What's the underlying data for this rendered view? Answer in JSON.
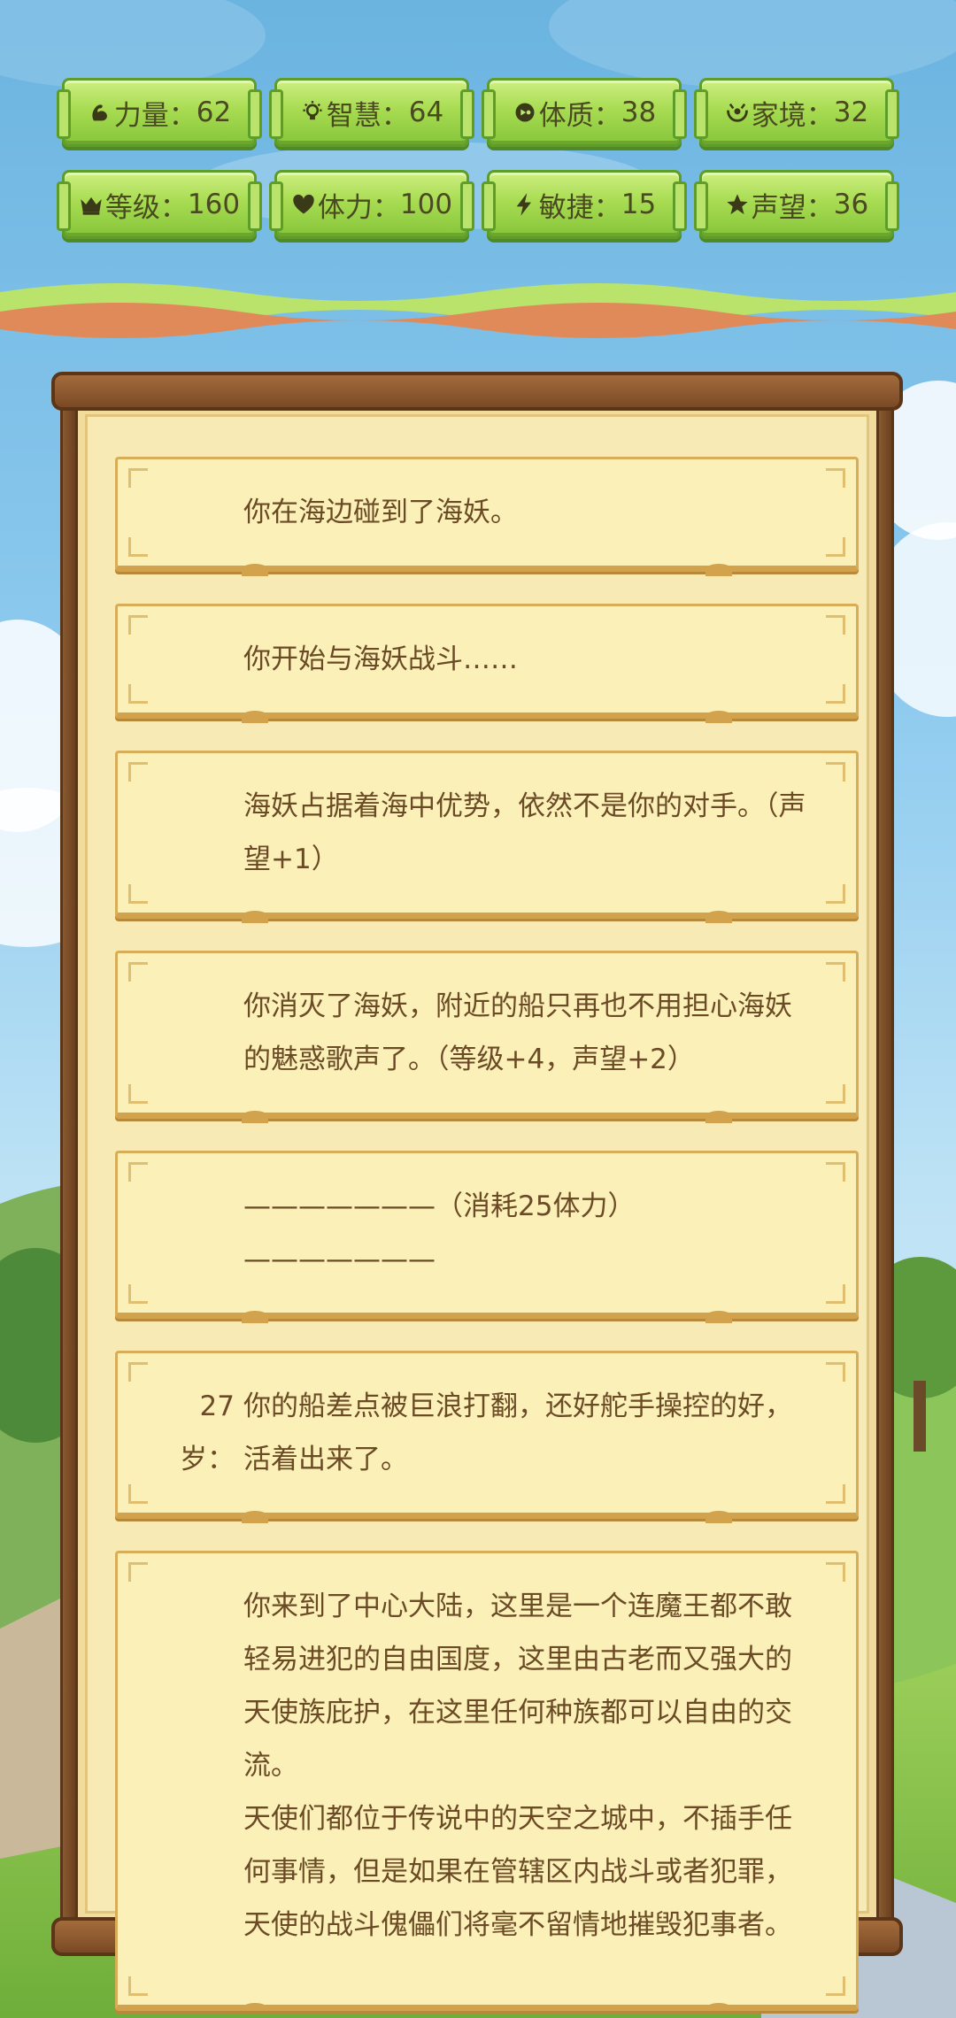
{
  "stats": [
    {
      "icon": "muscle-icon",
      "label": "力量",
      "value": "62"
    },
    {
      "icon": "lightbulb-icon",
      "label": "智慧",
      "value": "64"
    },
    {
      "icon": "physique-icon",
      "label": "体质",
      "value": "38"
    },
    {
      "icon": "family-icon",
      "label": "家境",
      "value": "32"
    },
    {
      "icon": "crown-icon",
      "label": "等级",
      "value": "160"
    },
    {
      "icon": "heart-icon",
      "label": "体力",
      "value": "100"
    },
    {
      "icon": "lightning-icon",
      "label": "敏捷",
      "value": "15"
    },
    {
      "icon": "star-icon",
      "label": "声望",
      "value": "36"
    }
  ],
  "stat_separator": "：",
  "log": [
    {
      "age": "",
      "text": "你在海边碰到了海妖。"
    },
    {
      "age": "",
      "text": "你开始与海妖战斗……"
    },
    {
      "age": "",
      "text": "海妖占据着海中优势，依然不是你的对手。（声望+1）"
    },
    {
      "age": "",
      "text": "你消灭了海妖，附近的船只再也不用担心海妖的魅惑歌声了。（等级+4，声望+2）"
    },
    {
      "age": "",
      "text": "———————（消耗25体力）———————"
    },
    {
      "age": "27岁：",
      "text": "你的船差点被巨浪打翻，还好舵手操控的好，活着出来了。"
    },
    {
      "age": "",
      "text": "你来到了中心大陆，这里是一个连魔王都不敢轻易进犯的自由国度，这里由古老而又强大的天使族庇护，在这里任何种族都可以自由的交流。\n天使们都位于传说中的天空之城中，不插手任何事情，但是如果在管辖区内战斗或者犯罪，天使的战斗傀儡们将毫不留情地摧毁犯事者。"
    }
  ]
}
